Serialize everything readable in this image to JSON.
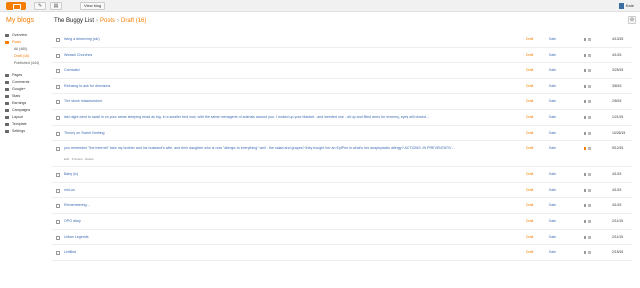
{
  "topbar": {
    "view_blog_label": "View blog",
    "user_name": "Kate"
  },
  "header": {
    "my_blogs": "My blogs",
    "blog_name": "The Buggy List",
    "section": "Posts",
    "current": "Draft (16)",
    "separator": "›"
  },
  "sidebar": {
    "items_top": [
      {
        "label": "Overview",
        "icon": "overview-icon"
      },
      {
        "label": "Posts",
        "icon": "posts-icon",
        "active": true
      }
    ],
    "subitems": [
      {
        "label": "All (460)"
      },
      {
        "label": "Draft (16)",
        "active": true
      },
      {
        "label": "Published (444)"
      }
    ],
    "items_bottom": [
      {
        "label": "Pages",
        "icon": "pages-icon"
      },
      {
        "label": "Comments",
        "icon": "comments-icon"
      },
      {
        "label": "Google+",
        "icon": "google-plus-icon"
      },
      {
        "label": "Stats",
        "icon": "stats-icon"
      },
      {
        "label": "Earnings",
        "icon": "earnings-icon"
      },
      {
        "label": "Campaigns",
        "icon": "campaigns-icon"
      },
      {
        "label": "Layout",
        "icon": "layout-icon"
      },
      {
        "label": "Template",
        "icon": "template-icon"
      },
      {
        "label": "Settings",
        "icon": "settings-icon"
      }
    ]
  },
  "posts": [
    {
      "title": "living a deserving (sic)",
      "status": "Draft",
      "author": "Kate",
      "date": "4/13/15"
    },
    {
      "title": "Weasel Churches",
      "status": "Draft",
      "author": "Kate",
      "date": "4/1/15"
    },
    {
      "title": "Carnivals!",
      "status": "Draft",
      "author": "Kate",
      "date": "3/25/15"
    },
    {
      "title": "Refusing to ask for directions",
      "status": "Draft",
      "author": "Kate",
      "date": "3/8/15"
    },
    {
      "title": "The stove misadventure",
      "status": "Draft",
      "author": "Kate",
      "date": "2/8/15"
    },
    {
      "title": "last night went to swall in on your areas sleeping head as big. in a smaller bed now, with the same menagerie of animals around you. I looked up your blanket - and weeded one - all up and filled arms for mommy, eyes still closed...",
      "status": "Draft",
      "author": "Kate",
      "date": "1/21/15"
    },
    {
      "title": "Theory on Sweet Nothing",
      "status": "Draft",
      "author": "Kate",
      "date": "10/26/15"
    },
    {
      "title": "you remember \"the Internet\" fake my brother and his husband's wife, and their daughter who is now \"allergic to everything\" well - the salad and grapes? they bought her an EpiPen in what's her anaphylactic allergy? ACTIONS: IN PREVENTATIVE, and then, my brother had the audio...",
      "status": "Draft",
      "author": "Kate",
      "date": "9/12/15",
      "actions": "Edit · Preview · Delete",
      "special": true
    },
    {
      "title": "Baby (ix)",
      "status": "Draft",
      "author": "Kate",
      "date": "4/1/15"
    },
    {
      "title": "mid-us",
      "status": "Draft",
      "author": "Kate",
      "date": "4/1/15"
    },
    {
      "title": "Remembering...",
      "status": "Draft",
      "author": "Kate",
      "date": "4/1/15"
    },
    {
      "title": "OPO diary",
      "status": "Draft",
      "author": "Kate",
      "date": "2/11/15"
    },
    {
      "title": "Urban Legends",
      "status": "Draft",
      "author": "Kate",
      "date": "2/11/15"
    },
    {
      "title": "Untitled",
      "status": "Draft",
      "author": "Kate",
      "date": "2/15/15"
    }
  ],
  "colors": {
    "accent": "#f57d00",
    "link": "#3d6bb3"
  }
}
